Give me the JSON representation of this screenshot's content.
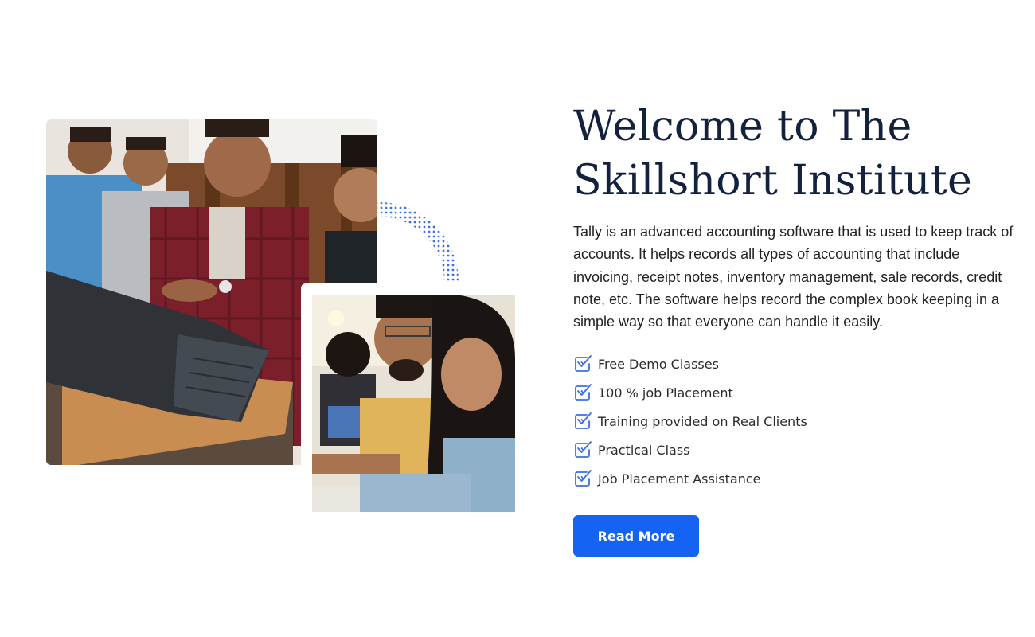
{
  "hero": {
    "title_line1": "Welcome to The",
    "title_line2": "Skillshort Institute",
    "description": "Tally is an advanced accounting software that is used to keep track of accounts. It helps records all types of accounting that include invoicing, receipt notes, inventory management, sale records, credit note, etc. The software helps record the complex book keeping in a simple way so that everyone can handle it easily.",
    "features": [
      {
        "label": "Free Demo Classes",
        "icon": "double-check-icon"
      },
      {
        "label": "100 % job Placement",
        "icon": "double-check-icon"
      },
      {
        "label": "Training provided on Real Clients",
        "icon": "double-check-icon"
      },
      {
        "label": "Practical Class",
        "icon": "double-check-icon"
      },
      {
        "label": "Job Placement Assistance",
        "icon": "double-check-icon"
      }
    ],
    "button_label": "Read More"
  },
  "images": {
    "main_photo": "students-with-laptop-photo",
    "secondary_photo": "smiling-students-in-class-photo",
    "decoration": "dotted-arc-decoration"
  },
  "colors": {
    "title": "#14213d",
    "body_text": "#222222",
    "accent": "#1463f3",
    "check_icon": "#3a6ee8",
    "background": "#ffffff"
  }
}
